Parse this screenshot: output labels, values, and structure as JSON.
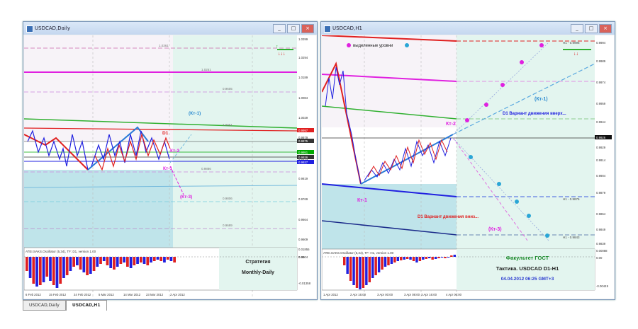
{
  "window_left": {
    "title": "USDCAD,Daily",
    "price_scale": [
      "1.0399",
      "1.0294",
      "1.0189",
      "1.0084",
      "1.0029",
      "0.9979",
      "0.9874",
      "0.9819",
      "0.9769",
      "0.9664",
      "0.9609",
      "0.9504"
    ],
    "current_price_tags": [
      "0.9997",
      "0.9975",
      "0.9951",
      "0.9936",
      "0.9937"
    ],
    "level_labels": [
      "1.0361",
      "1.0251",
      "1.0051",
      "0.9886",
      "0.9806",
      "0.9689",
      "0.9605"
    ],
    "annotations": {
      "kt1_up": "(Кт-1)",
      "kt2": "Кт-2",
      "kt1": "Кт-1",
      "kt3": "(Кт-3)",
      "d1": "D1"
    },
    "oscillator_label": "ATEI.SAKS.Oscillator (5,34), TF: D1, version 1.00",
    "osc_scale": [
      "0.01855",
      "0.00",
      "-0.01358"
    ],
    "strategy_title": "Стратегия",
    "strategy_subtitle": "Monthly-Daily",
    "time_labels": [
      "6 Feb 2012",
      "15 Feb 2012",
      "24 Feb 2012",
      "5 Mar 2012",
      "14 Mar 2012",
      "23 Mar 2012",
      "2 Apr 2012"
    ]
  },
  "window_right": {
    "title": "USDCAD,H1",
    "legend_text": "выделенные уровни",
    "price_scale": [
      "0.9994",
      "0.9989",
      "0.9974",
      "0.9959",
      "0.9944",
      "0.9929",
      "0.9914",
      "0.9904",
      "0.9879",
      "0.9864",
      "0.9849",
      "0.9839"
    ],
    "current_price_tag": "0.9926",
    "level_labels": [
      "H1 - 0.9996",
      "H1 - 0.9876",
      "H1 - 0.9843"
    ],
    "annotations": {
      "kt1_up": "(Кт-1)",
      "variant_up": "D1 Вариант движения вверх...",
      "kt2": "Кт-2",
      "kt1": "Кт-1",
      "variant_down": "D1 Вариант движения вниз...",
      "kt3": "(Кт-3)"
    },
    "oscillator_label": "ATEI.SAKS.Oscillator (5,34), TF: H1, version 1.00",
    "osc_scale": [
      "0.00088",
      "0.00",
      "-0.00449"
    ],
    "faculty_title": "Факультет ГОСТ",
    "tactic_title": "Тактика. USDCAD D1-H1",
    "date_text": "04.04.2012 06:25 GMT+3",
    "time_labels": [
      "1 Apr 2012",
      "2 Apr 16:00",
      "3 Apr 00:00",
      "3 Apr 08:00",
      "3 Apr 16:00",
      "4 Apr 00:00"
    ]
  },
  "tabs": [
    "USDCAD,Daily",
    "USDCAD,H1"
  ],
  "colors": {
    "bull": "#2020e0",
    "bear": "#e02020",
    "magenta": "#e020e0",
    "green": "#30b030",
    "teal": "#2aa6a6",
    "light_bg": "#e0f5ee"
  }
}
